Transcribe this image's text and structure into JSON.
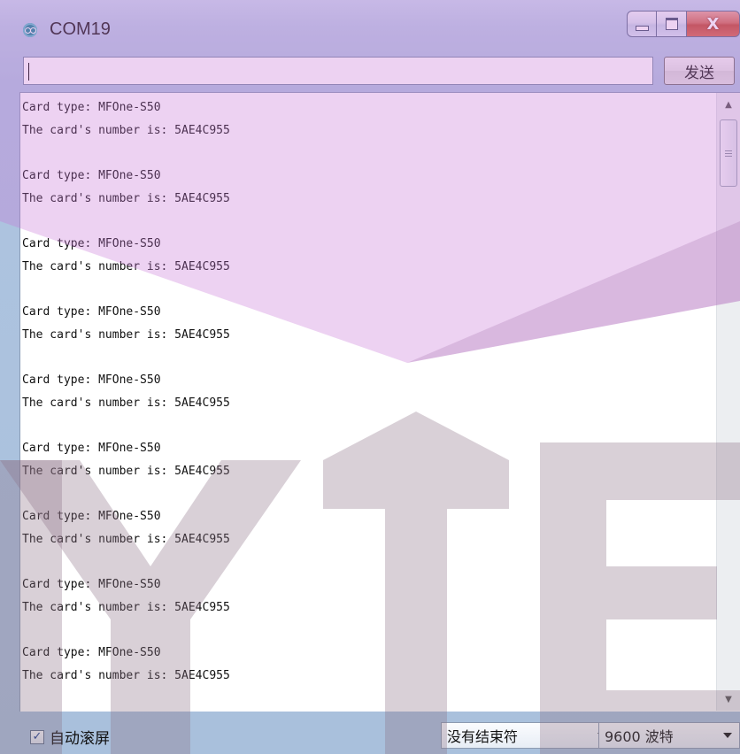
{
  "window": {
    "title": "COM19",
    "icons": {
      "app": "arduino-icon",
      "minimize": "minimize-icon",
      "maximize": "maximize-icon",
      "close": "close-icon"
    },
    "close_glyph": "X"
  },
  "send_row": {
    "input_value": "",
    "send_label": "发送"
  },
  "output": {
    "lines": [
      "Card type: MFOne-S50",
      "The card's number is: 5AE4C955",
      "",
      "Card type: MFOne-S50",
      "The card's number is: 5AE4C955",
      "",
      "Card type: MFOne-S50",
      "The card's number is: 5AE4C955",
      "",
      "Card type: MFOne-S50",
      "The card's number is: 5AE4C955",
      "",
      "Card type: MFOne-S50",
      "The card's number is: 5AE4C955",
      "",
      "Card type: MFOne-S50",
      "The card's number is: 5AE4C955",
      "",
      "Card type: MFOne-S50",
      "The card's number is: 5AE4C955",
      "",
      "Card type: MFOne-S50",
      "The card's number is: 5AE4C955",
      "",
      "Card type: MFOne-S50",
      "The card's number is: 5AE4C955"
    ],
    "scrollbar_icons": {
      "up": "scroll-up-arrow-icon",
      "down": "scroll-down-arrow-icon"
    }
  },
  "bottom_bar": {
    "autoscroll_label": "自动滚屏",
    "autoscroll_checked": true,
    "line_ending_value": "没有结束符",
    "baud_value": "9600 波特"
  },
  "colors": {
    "watermark_purple": "#c873d8",
    "watermark_gray": "#8c6f86",
    "close_button": "#c9502f",
    "window_frame": "#b9cde6"
  }
}
